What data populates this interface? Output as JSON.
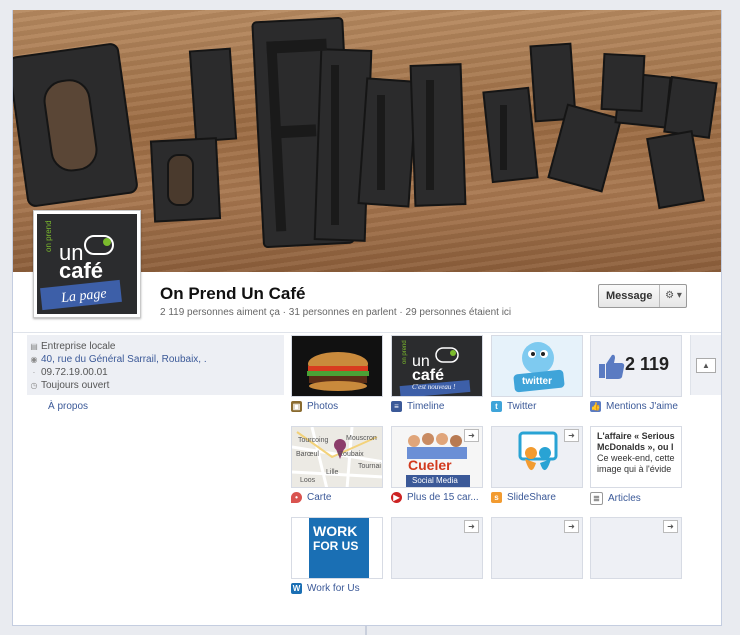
{
  "page": {
    "title": "On Prend Un Café",
    "stats": "2 119 personnes aiment ça · 31 personnes en parlent · 29 personnes étaient ici",
    "message_label": "Message",
    "gear_label": "⚙ ▾",
    "profile_logo": {
      "top_text": "on prend",
      "un": "un",
      "cafe": "café",
      "banner": "La page"
    }
  },
  "info": {
    "category": "Entreprise locale",
    "address": "40, rue du Général Sarrail, Roubaix, .",
    "phone": "09.72.19.00.01",
    "hours": "Toujours ouvert",
    "about_link": "À propos"
  },
  "tiles": [
    {
      "label": "Photos",
      "icon": "photos-icon"
    },
    {
      "label": "Timeline",
      "icon": "timeline-icon",
      "thumb_banner": "C'est nouveau !"
    },
    {
      "label": "Twitter",
      "icon": "twitter-icon",
      "thumb_text": "twitter"
    },
    {
      "label": "Mentions J'aime",
      "icon": "thumbs-up-icon",
      "count": "2 119"
    },
    {
      "label": "Carte",
      "icon": "map-pin-icon",
      "map_labels": [
        "Tourcoing",
        "Mouscron",
        "Barœul",
        "Roubaix",
        "Lille",
        "Tournai",
        "Loos"
      ]
    },
    {
      "label": "Plus de 15 car...",
      "icon": "video-icon",
      "thumb_title": "Cueler",
      "thumb_sub": "Social Media"
    },
    {
      "label": "SlideShare",
      "icon": "slideshare-icon"
    },
    {
      "label": "Articles",
      "icon": "notes-icon",
      "article_lines": [
        "L'affaire « Serious",
        "McDonalds », ou l",
        "Ce week-end, cette",
        "image qui à l'évide"
      ]
    },
    {
      "label": "Work for Us",
      "icon": "work-icon",
      "thumb_line1": "WORK",
      "thumb_line2": "FOR US"
    }
  ],
  "empty_slots_plus": "➜",
  "colors": {
    "link": "#3b5998",
    "twitter_blue": "#3fa4d9",
    "slideshare_orange": "#f29b30"
  }
}
